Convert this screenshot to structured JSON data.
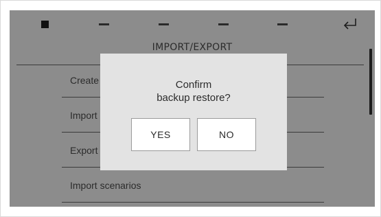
{
  "toolbar": {
    "icons": [
      "stop-icon",
      "dash-icon",
      "dash-icon",
      "dash-icon",
      "dash-icon",
      "return-icon"
    ]
  },
  "screen": {
    "title": "IMPORT/EXPORT",
    "menu": [
      {
        "label": "Create backup"
      },
      {
        "label": "Import backup"
      },
      {
        "label": "Export backup"
      },
      {
        "label": "Import scenarios"
      }
    ]
  },
  "dialog": {
    "message_line1": "Confirm",
    "message_line2": "backup restore?",
    "yes_label": "YES",
    "no_label": "NO"
  },
  "colors": {
    "screen_bg": "#8c8c8c",
    "dialog_bg": "#e3e3e3",
    "button_bg": "#ffffff"
  }
}
